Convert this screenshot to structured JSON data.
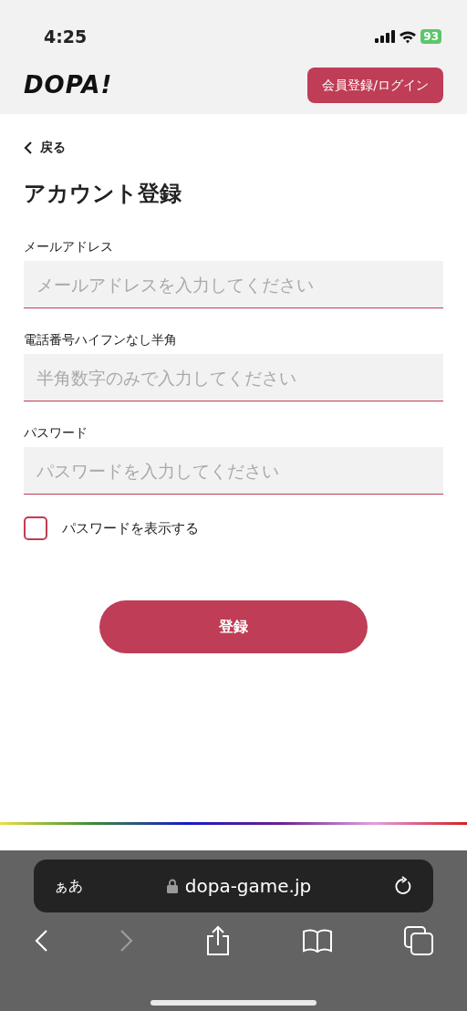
{
  "status_bar": {
    "time": "4:25",
    "battery": "93"
  },
  "header": {
    "logo": "DOPA!",
    "login_button": "会員登録/ログイン"
  },
  "back_link": "戻る",
  "title": "アカウント登録",
  "fields": [
    {
      "label": "メールアドレス",
      "placeholder": "メールアドレスを入力してください"
    },
    {
      "label": "電話番号ハイフンなし半角",
      "placeholder": "半角数字のみで入力してください"
    },
    {
      "label": "パスワード",
      "placeholder": "パスワードを入力してください"
    }
  ],
  "show_password": {
    "label": "パスワードを表示する",
    "checked": false
  },
  "submit_button": "登録",
  "browser": {
    "text_size": "ぁあ",
    "url": "dopa-game.jp"
  }
}
